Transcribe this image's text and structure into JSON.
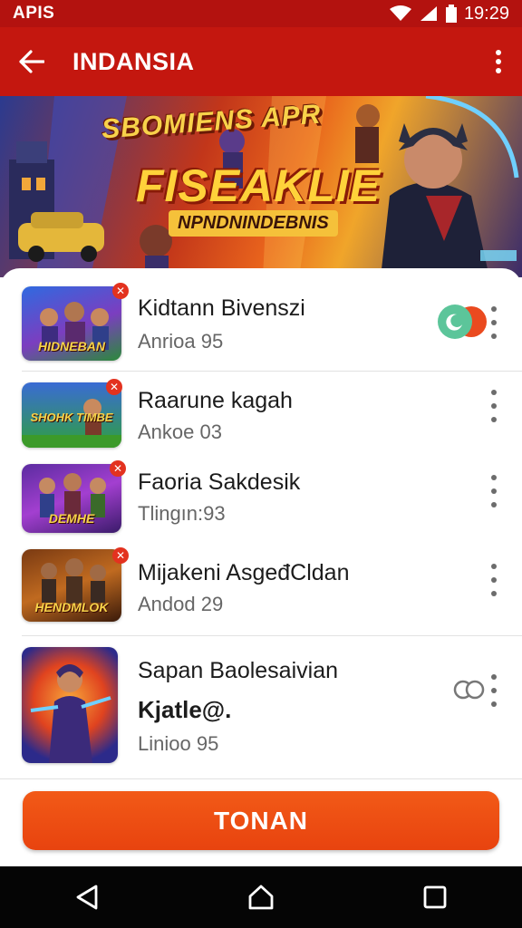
{
  "status_bar": {
    "left_text": "APIS",
    "time": "19:29",
    "icons": [
      "wifi-icon",
      "signal-icon",
      "battery-icon"
    ]
  },
  "app_bar": {
    "title": "INDANSIA",
    "back_icon": "arrow-back-icon",
    "menu_icon": "more-vert-icon"
  },
  "banner": {
    "title": "SBOMIENS APR",
    "subtitle": "FISEAKLIE",
    "strip": "NPNDNINDEBNIS"
  },
  "list": {
    "items": [
      {
        "thumb_text": "HIDNEBAN",
        "title": "Kidtann Bivenszi",
        "subtitle": "Anrioa 95",
        "extra": "",
        "action": "toggle-on"
      },
      {
        "thumb_text": "SHOHK TIMBE",
        "title": "Raarune kagah",
        "subtitle": "Ankoe 03",
        "extra": "",
        "action": ""
      },
      {
        "thumb_text": "DEMHE",
        "title": "Faoria Sakdesik",
        "subtitle": "Tlingın:93",
        "extra": "",
        "action": ""
      },
      {
        "thumb_text": "HENDMLOK",
        "title": "Mijakeni AsgeđCldan",
        "subtitle": "Andod 29",
        "extra": "",
        "action": ""
      },
      {
        "thumb_text": "",
        "title": "Sapan Baolesaivian",
        "subtitle": "Linioo 95",
        "extra": "Kjatle@.",
        "action": "toggle-off"
      }
    ]
  },
  "cta": {
    "label": "TONAN"
  },
  "nav_bar": {
    "buttons": [
      "back-triangle-icon",
      "home-icon",
      "recents-square-icon"
    ]
  },
  "colors": {
    "app_bar": "#c4170f",
    "status_bar": "#b3120f",
    "accent": "#f0501a",
    "toggle_on": "#5cc59a"
  }
}
